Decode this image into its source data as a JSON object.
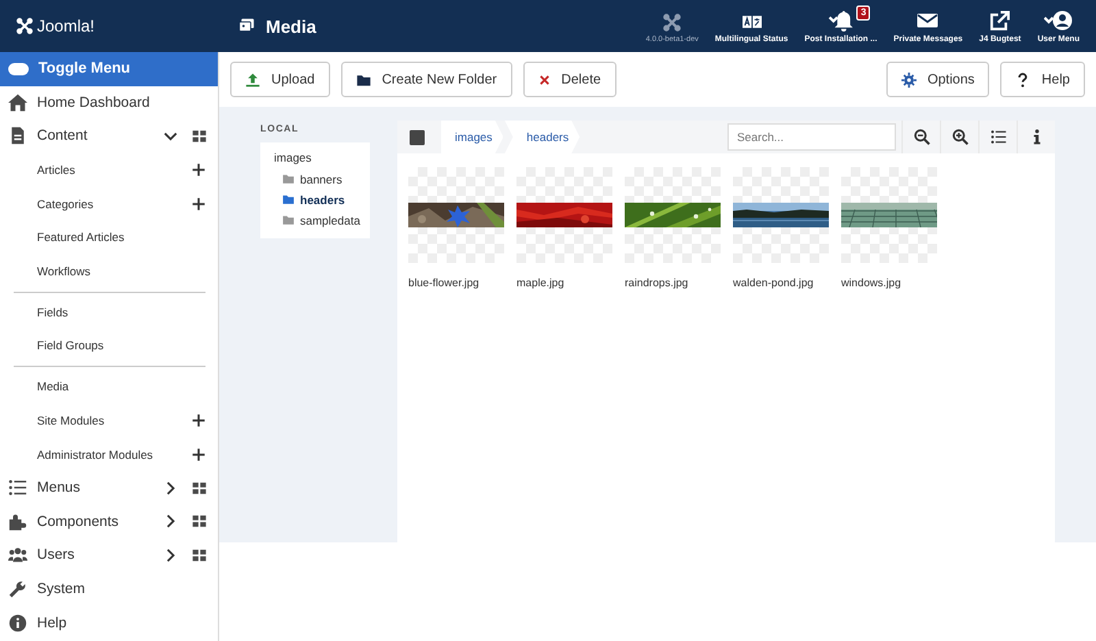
{
  "header": {
    "brand": "Joomla!",
    "title": "Media",
    "version": "4.0.0-beta1-dev",
    "items": [
      {
        "label": "Multilingual Status"
      },
      {
        "label": "Post Installation ...",
        "badge": "3"
      },
      {
        "label": "Private Messages"
      },
      {
        "label": "J4 Bugtest"
      },
      {
        "label": "User Menu"
      }
    ]
  },
  "sidebar": {
    "toggle": "Toggle Menu",
    "items": [
      {
        "label": "Home Dashboard"
      },
      {
        "label": "Content",
        "expanded": true,
        "dashboard": true,
        "children": [
          {
            "label": "Articles",
            "add": true
          },
          {
            "label": "Categories",
            "add": true
          },
          {
            "label": "Featured Articles",
            "add": false
          },
          {
            "label": "Workflows",
            "add": false
          },
          {
            "label": "Fields",
            "add": false,
            "divider_before": true
          },
          {
            "label": "Field Groups",
            "add": false
          },
          {
            "label": "Media",
            "add": false,
            "divider_before": true
          },
          {
            "label": "Site Modules",
            "add": true
          },
          {
            "label": "Administrator Modules",
            "add": true
          }
        ]
      },
      {
        "label": "Menus",
        "expanded": false,
        "dashboard": true
      },
      {
        "label": "Components",
        "expanded": false,
        "dashboard": true
      },
      {
        "label": "Users",
        "expanded": false,
        "dashboard": true
      },
      {
        "label": "System"
      },
      {
        "label": "Help"
      }
    ]
  },
  "toolbar": {
    "left": [
      "Upload",
      "Create New Folder",
      "Delete"
    ],
    "right": [
      "Options",
      "Help"
    ]
  },
  "media": {
    "tree": {
      "title": "LOCAL",
      "root": "images",
      "children": [
        {
          "label": "banners",
          "selected": false
        },
        {
          "label": "headers",
          "selected": true
        },
        {
          "label": "sampledata",
          "selected": false
        }
      ]
    },
    "select_all": {
      "checked": false
    },
    "breadcrumb": [
      "images",
      "headers"
    ],
    "search": {
      "placeholder": "Search..."
    },
    "files": [
      {
        "name": "blue-flower.jpg",
        "kind": "picture"
      },
      {
        "name": "maple.jpg",
        "kind": "picture"
      },
      {
        "name": "raindrops.jpg",
        "kind": "picture"
      },
      {
        "name": "walden-pond.jpg",
        "kind": "picture"
      },
      {
        "name": "windows.jpg",
        "kind": "picture"
      }
    ]
  }
}
